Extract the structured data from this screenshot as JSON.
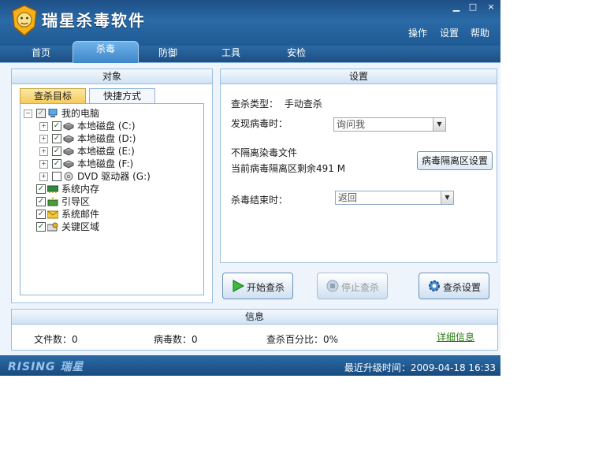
{
  "app": {
    "title": "瑞星杀毒软件",
    "window_buttons": {
      "minimize": "▁",
      "maximize": "□",
      "close": "×"
    }
  },
  "top_menu": {
    "ops": "操作",
    "settings": "设置",
    "help": "帮助"
  },
  "tabs": {
    "home": "首页",
    "scan": "杀毒",
    "defense": "防御",
    "tools": "工具",
    "check": "安检"
  },
  "target_panel": {
    "title": "对象",
    "subtabs": {
      "target": "查杀目标",
      "shortcut": "快捷方式"
    },
    "tree": [
      {
        "label": "我的电脑"
      },
      {
        "label": "本地磁盘 (C:)"
      },
      {
        "label": "本地磁盘 (D:)"
      },
      {
        "label": "本地磁盘 (E:)"
      },
      {
        "label": "本地磁盘 (F:)"
      },
      {
        "label": "DVD 驱动器 (G:)"
      },
      {
        "label": "系统内存"
      },
      {
        "label": "引导区"
      },
      {
        "label": "系统邮件"
      },
      {
        "label": "关键区域"
      }
    ]
  },
  "settings_panel": {
    "title": "设置",
    "scan_type_label": "查杀类型：",
    "scan_type_value": "手动查杀",
    "on_virus_label": "发现病毒时：",
    "on_virus_value": "询问我",
    "no_quarantine": "不隔离染毒文件",
    "quarantine_remaining": "当前病毒隔离区剩余491 M",
    "quarantine_settings_button": "病毒隔离区设置",
    "on_finish_label": "杀毒结束时：",
    "on_finish_value": "返回"
  },
  "actions": {
    "start": "开始查杀",
    "stop": "停止查杀",
    "scan_settings": "查杀设置"
  },
  "info_panel": {
    "title": "信息",
    "files": "文件数：0",
    "viruses": "病毒数：0",
    "percent": "查杀百分比：0%",
    "details": "详细信息"
  },
  "status": {
    "brand": "RISING 瑞星",
    "last_update": "最近升级时间：2009-04-18 16:33"
  }
}
